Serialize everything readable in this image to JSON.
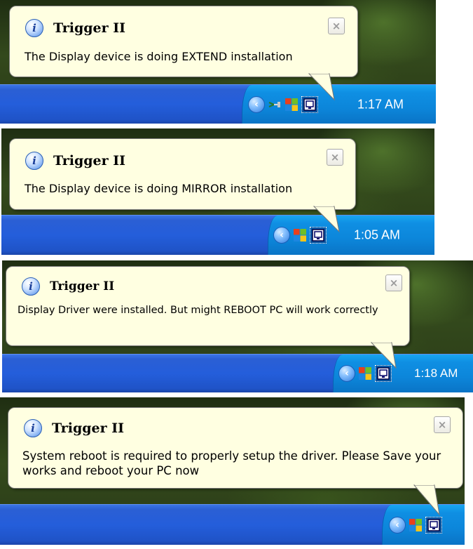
{
  "notifications": [
    {
      "title": "Trigger II",
      "message": "The Display device is doing EXTEND installation",
      "close_label": "×",
      "info_glyph": "i",
      "clock": "1:17 AM",
      "tray_icons": [
        "show-hidden-icons-chevron-icon",
        "network-cable-icon",
        "windows-security-icon",
        "display-device-icon"
      ]
    },
    {
      "title": "Trigger II",
      "message": "The Display device is doing MIRROR installation",
      "close_label": "×",
      "info_glyph": "i",
      "clock": "1:05 AM",
      "tray_icons": [
        "show-hidden-icons-chevron-icon",
        "windows-security-icon",
        "display-device-icon"
      ]
    },
    {
      "title": "Trigger II",
      "message": "Display Driver were installed. But might REBOOT PC will work correctly",
      "close_label": "×",
      "info_glyph": "i",
      "clock": "1:18 AM",
      "tray_icons": [
        "show-hidden-icons-chevron-icon",
        "windows-security-icon",
        "display-device-icon"
      ]
    },
    {
      "title": "Trigger II",
      "message": "System reboot is required to properly setup the driver. Please Save your works and reboot your PC now",
      "close_label": "×",
      "info_glyph": "i",
      "tray_icons": [
        "show-hidden-icons-chevron-icon",
        "windows-security-icon",
        "display-device-icon"
      ]
    }
  ],
  "colors": {
    "balloon_bg": "#ffffe1",
    "taskbar_blue": "#245edb",
    "tray_blue": "#0c86da"
  }
}
